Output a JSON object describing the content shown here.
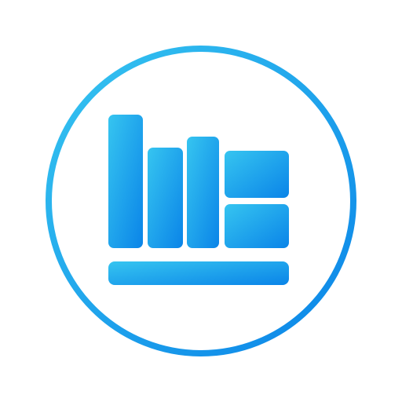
{
  "icon": {
    "name": "library-bookshelf-icon",
    "colors": {
      "gradient_start": "#36C5F0",
      "gradient_end": "#0A84E8",
      "background": "#FFFFFF"
    },
    "parts": [
      "ring",
      "tall-book",
      "book-2",
      "book-3",
      "upper-drawer",
      "lower-drawer",
      "shelf-base"
    ]
  }
}
